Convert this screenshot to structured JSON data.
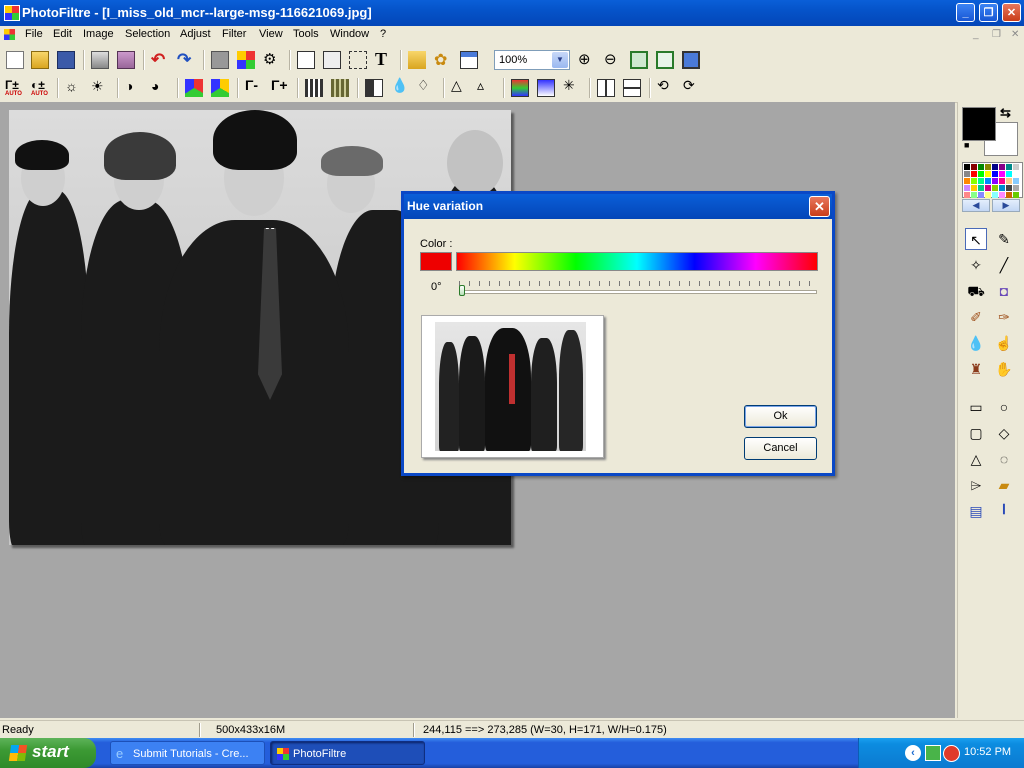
{
  "window": {
    "title": "PhotoFiltre - [I_miss_old_mcr--large-msg-116621069.jpg]",
    "minimize": "_",
    "restore": "❐",
    "close": "✕"
  },
  "menu": {
    "items": [
      "File",
      "Edit",
      "Image",
      "Selection",
      "Adjust",
      "Filter",
      "View",
      "Tools",
      "Window",
      "?"
    ],
    "mdi_minimize": "_",
    "mdi_restore": "❐",
    "mdi_close": "✕"
  },
  "toolbar": {
    "zoom_value": "100%",
    "auto_label": "AUTO"
  },
  "dialog": {
    "title": "Hue variation",
    "color_label": "Color :",
    "angle_value": "0°",
    "hue": 0,
    "ok_label": "Ok",
    "cancel_label": "Cancel",
    "color_swatch": "#ee0000"
  },
  "colors": {
    "foreground": "#000000",
    "background": "#ffffff"
  },
  "status": {
    "ready": "Ready",
    "image_info": "500x433x16M",
    "coords": "244,115 ==> 273,285 (W=30, H=171, W/H=0.175)"
  },
  "taskbar": {
    "start_label": "start",
    "items": [
      {
        "label": "Submit Tutorials - Cre..."
      },
      {
        "label": "PhotoFiltre"
      }
    ],
    "clock": "10:52 PM"
  }
}
